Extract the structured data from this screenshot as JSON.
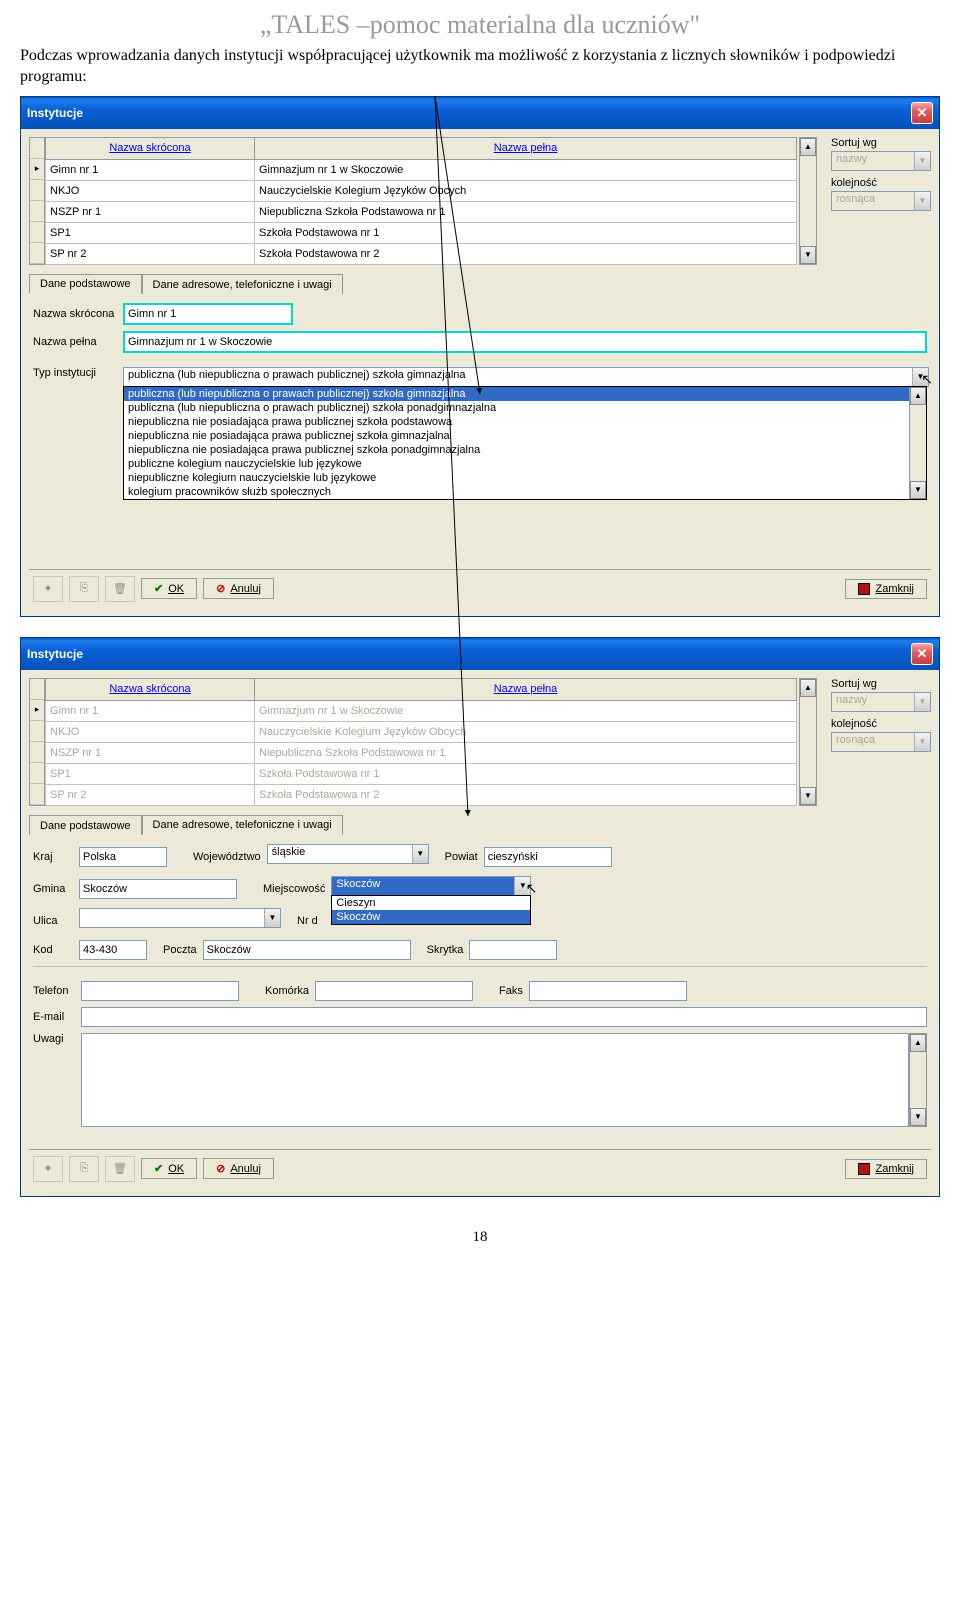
{
  "doc": {
    "title": "„TALES –pomoc materialna dla uczniów\"",
    "desc": "Podczas wprowadzania danych instytucji współpracującej użytkownik ma możliwość z korzystania z licznych słowników i podpowiedzi programu:",
    "pagenum": "18"
  },
  "win": {
    "title": "Instytucje",
    "headers": {
      "short": "Nazwa skrócona",
      "full": "Nazwa pełna"
    },
    "rows": [
      {
        "short": "Gimn nr 1",
        "full": "Gimnazjum nr 1 w Skoczowie"
      },
      {
        "short": "NKJO",
        "full": "Nauczycielskie Kolegium Języków Obcych"
      },
      {
        "short": "NSZP nr 1",
        "full": "Niepubliczna Szkoła Podstawowa nr 1"
      },
      {
        "short": "SP1",
        "full": "Szkoła Podstawowa nr 1"
      },
      {
        "short": "SP nr 2",
        "full": "Szkoła Podstawowa nr 2"
      }
    ],
    "sort": {
      "label1": "Sortuj wg",
      "val1": "nazwy",
      "label2": "kolejność",
      "val2": "rosnąca"
    },
    "tabs": {
      "t1": "Dane podstawowe",
      "t2": "Dane adresowe, telefoniczne i uwagi"
    },
    "buttons": {
      "ok": "OK",
      "cancel": "Anuluj",
      "close": "Zamknij"
    }
  },
  "form1": {
    "l_short": "Nazwa skrócona",
    "v_short": "Gimn nr 1",
    "l_full": "Nazwa pełna",
    "v_full": "Gimnazjum nr 1 w Skoczowie",
    "l_type": "Typ instytucji",
    "v_type": "publiczna (lub niepubliczna o prawach publicznej) szkoła gimnazjalna",
    "options": [
      "publiczna (lub niepubliczna o prawach publicznej) szkoła gimnazjalna",
      "publiczna (lub niepubliczna o prawach publicznej) szkoła ponadgimnazjalna",
      "niepubliczna nie posiadająca prawa publicznej szkoła podstawowa",
      "niepubliczna nie posiadająca prawa publicznej szkoła gimnazjalna",
      "niepubliczna nie posiadająca prawa publicznej szkoła ponadgimnazjalna",
      "publiczne kolegium nauczycielskie lub językowe",
      "niepubliczne kolegium nauczycielskie lub językowe",
      "kolegium pracowników służb społecznych"
    ]
  },
  "form2": {
    "l_kraj": "Kraj",
    "v_kraj": "Polska",
    "l_woj": "Województwo",
    "v_woj": "śląskie",
    "l_pow": "Powiat",
    "v_pow": "cieszyński",
    "l_gmina": "Gmina",
    "v_gmina": "Skoczów",
    "l_miej": "Miejscowość",
    "v_miej": "Skoczów",
    "miej_opts": [
      "Cieszyn",
      "Skoczów"
    ],
    "l_ulica": "Ulica",
    "l_nrd": "Nr d",
    "l_kod": "Kod",
    "v_kod": "43-430",
    "l_poczta": "Poczta",
    "v_poczta": "Skoczów",
    "l_skrytka": "Skrytka",
    "l_tel": "Telefon",
    "l_kom": "Komórka",
    "l_faks": "Faks",
    "l_email": "E-mail",
    "l_uwagi": "Uwagi"
  }
}
